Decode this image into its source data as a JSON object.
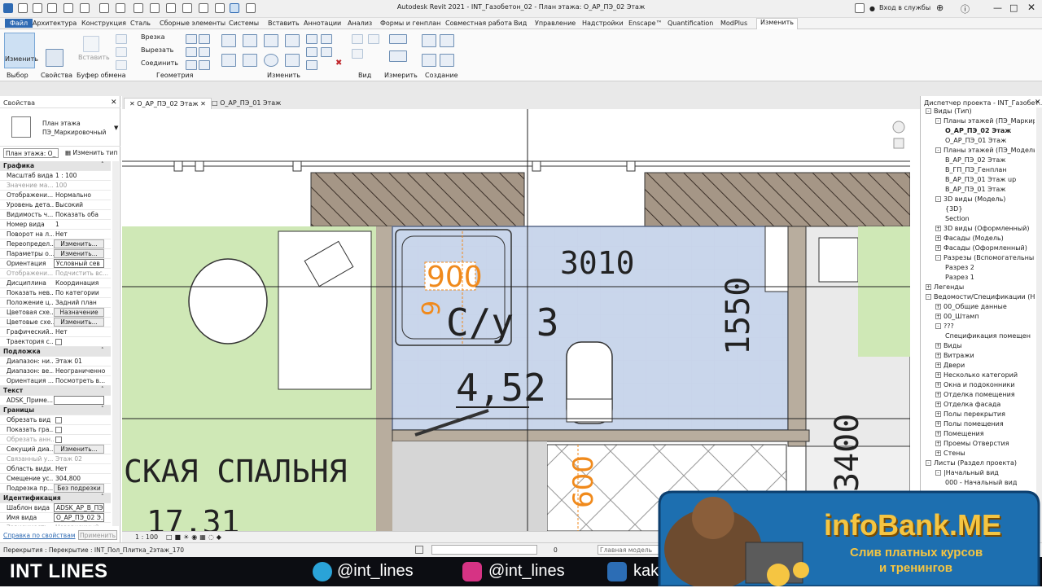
{
  "app": {
    "title": "Autodesk Revit 2021 - INT_Газобетон_02 - План этажа: О_АР_ПЭ_02 Этаж",
    "signin": "Вход в службы"
  },
  "ribbon": {
    "tabs": [
      "Файл",
      "Архитектура",
      "Конструкция",
      "Сталь",
      "Сборные элементы",
      "Системы",
      "Вставить",
      "Аннотации",
      "Анализ",
      "Формы и генплан",
      "Совместная работа",
      "Вид",
      "Управление",
      "Надстройки",
      "Enscape™",
      "Quantification",
      "ModPlus",
      "Изменить"
    ],
    "groups": [
      "Выбор",
      "Свойства",
      "Буфер обмена",
      "Геометрия",
      "Изменить",
      "Вид",
      "Измерить",
      "Создание"
    ],
    "modify_label": "Изменить",
    "insert_label": "Вставить",
    "cut_label": "Врезка",
    "trim_label": "Вырезать",
    "join_label": "Соединить"
  },
  "properties": {
    "title": "Свойства",
    "type_line1": "План этажа",
    "type_line2": "ПЭ_Маркировочный",
    "selector": "План этажа: О_",
    "edit_type": "Изменить тип",
    "rows": [
      {
        "k": "Графика",
        "sec": true
      },
      {
        "k": "Масштаб вида",
        "v": "1 : 100"
      },
      {
        "k": "Значение ма...",
        "v": "100",
        "dis": true
      },
      {
        "k": "Отображени...",
        "v": "Нормально"
      },
      {
        "k": "Уровень дета...",
        "v": "Высокий"
      },
      {
        "k": "Видимость ч...",
        "v": "Показать оба"
      },
      {
        "k": "Номер вида",
        "v": "1"
      },
      {
        "k": "Поворот на л...",
        "v": "Нет"
      },
      {
        "k": "Переопредел...",
        "btn": "Изменить..."
      },
      {
        "k": "Параметры о...",
        "btn": "Изменить..."
      },
      {
        "k": "Ориентация",
        "input": "Условный сев"
      },
      {
        "k": "Отображени...",
        "v": "Подчистить вс...",
        "dis": true
      },
      {
        "k": "Дисциплина",
        "v": "Координация"
      },
      {
        "k": "Показать нев...",
        "v": "По категории"
      },
      {
        "k": "Положение ц...",
        "v": "Задний план"
      },
      {
        "k": "Цветовая схе...",
        "btn": "Назначение"
      },
      {
        "k": "Цветовые схе...",
        "btn": "Изменить..."
      },
      {
        "k": "Графический...",
        "v": "Нет"
      },
      {
        "k": "Траектория с...",
        "cb": true
      },
      {
        "k": "Подложка",
        "sec": true
      },
      {
        "k": "Диапазон: ни...",
        "v": "Этаж 01"
      },
      {
        "k": "Диапазон: ве...",
        "v": "Неограниченно"
      },
      {
        "k": "Ориентация ...",
        "v": "Посмотреть в..."
      },
      {
        "k": "Текст",
        "sec": true
      },
      {
        "k": "ADSK_Приме...",
        "input": ""
      },
      {
        "k": "Границы",
        "sec": true
      },
      {
        "k": "Обрезать вид",
        "cb": true
      },
      {
        "k": "Показать гра...",
        "cb": true
      },
      {
        "k": "Обрезать анн...",
        "cb": true,
        "dis": true
      },
      {
        "k": "Секущий диа...",
        "btn": "Изменить..."
      },
      {
        "k": "Связанный у...",
        "v": "Этаж 02",
        "dis": true
      },
      {
        "k": "Область види...",
        "v": "Нет"
      },
      {
        "k": "Смещение ус...",
        "v": "304,800"
      },
      {
        "k": "Подрезка пр...",
        "btn": "Без подрезки"
      },
      {
        "k": "Идентификация",
        "sec": true
      },
      {
        "k": "Шаблон вида",
        "input": "ADSK_АР_В_ПЭ"
      },
      {
        "k": "Имя вида",
        "input": "О_АР_ПЭ_02 Э..."
      },
      {
        "k": "Зависимость",
        "v": "Независимый",
        "dis": true
      }
    ],
    "help_link": "Справка по свойствам",
    "apply": "Применить"
  },
  "view_tabs": [
    "О_АР_ПЭ_02 Этаж",
    "О_АР_ПЭ_01 Этаж"
  ],
  "drawing": {
    "dim_3010": "3010",
    "dim_900": "900",
    "dim_900_partial": "9",
    "room_name": "С/у 3",
    "room_area": "4,52",
    "dim_1550": "1550",
    "dim_3400": "3400",
    "dim_600": "600",
    "bedroom": "СКАЯ СПАЛЬНЯ",
    "bedroom_area": "17,31"
  },
  "view_control": {
    "scale": "1 : 100"
  },
  "browser": {
    "title": "Диспетчер проекта - INT_Газобет...",
    "items": [
      {
        "t": "Виды (Тип)",
        "lvl": 0,
        "tw": "-"
      },
      {
        "t": "Планы этажей (ПЭ_Маркиро",
        "lvl": 1,
        "tw": "-"
      },
      {
        "t": "О_АР_ПЭ_02 Этаж",
        "lvl": 2,
        "sel": true
      },
      {
        "t": "О_АР_ПЭ_01 Этаж",
        "lvl": 2
      },
      {
        "t": "Планы этажей (ПЭ_Модель",
        "lvl": 1,
        "tw": "-"
      },
      {
        "t": "В_АР_ПЭ_02 Этаж",
        "lvl": 2
      },
      {
        "t": "В_ГП_ПЭ_Генплан",
        "lvl": 2
      },
      {
        "t": "В_АР_ПЭ_01 Этаж up",
        "lvl": 2
      },
      {
        "t": "В_АР_ПЭ_01 Этаж",
        "lvl": 2
      },
      {
        "t": "3D виды (Модель)",
        "lvl": 1,
        "tw": "-"
      },
      {
        "t": "{3D}",
        "lvl": 2
      },
      {
        "t": "Section",
        "lvl": 2
      },
      {
        "t": "3D виды (Оформленный)",
        "lvl": 1,
        "tw": "+"
      },
      {
        "t": "Фасады (Модель)",
        "lvl": 1,
        "tw": "+"
      },
      {
        "t": "Фасады (Оформленный)",
        "lvl": 1,
        "tw": "+"
      },
      {
        "t": "Разрезы (Вспомогательный",
        "lvl": 1,
        "tw": "-"
      },
      {
        "t": "Разрез 2",
        "lvl": 2
      },
      {
        "t": "Разрез 1",
        "lvl": 2
      },
      {
        "t": "Легенды",
        "lvl": 0,
        "tw": "+"
      },
      {
        "t": "Ведомости/Спецификации (Н",
        "lvl": 0,
        "tw": "-"
      },
      {
        "t": "00_Общие данные",
        "lvl": 1,
        "tw": "+"
      },
      {
        "t": "00_Штамп",
        "lvl": 1,
        "tw": "+"
      },
      {
        "t": "???",
        "lvl": 1,
        "tw": "-"
      },
      {
        "t": "Спецификация помещен",
        "lvl": 2
      },
      {
        "t": "Виды",
        "lvl": 1,
        "tw": "+"
      },
      {
        "t": "Витражи",
        "lvl": 1,
        "tw": "+"
      },
      {
        "t": "Двери",
        "lvl": 1,
        "tw": "+"
      },
      {
        "t": "Несколько категорий",
        "lvl": 1,
        "tw": "+"
      },
      {
        "t": "Окна и подоконники",
        "lvl": 1,
        "tw": "+"
      },
      {
        "t": "Отделка помещения",
        "lvl": 1,
        "tw": "+"
      },
      {
        "t": "Отделка фасада",
        "lvl": 1,
        "tw": "+"
      },
      {
        "t": "Полы перекрытия",
        "lvl": 1,
        "tw": "+"
      },
      {
        "t": "Полы помещения",
        "lvl": 1,
        "tw": "+"
      },
      {
        "t": "Помещения",
        "lvl": 1,
        "tw": "+"
      },
      {
        "t": "Проемы Отверстия",
        "lvl": 1,
        "tw": "+"
      },
      {
        "t": "Стены",
        "lvl": 1,
        "tw": "+"
      },
      {
        "t": "Листы (Раздел проекта)",
        "lvl": 0,
        "tw": "-"
      },
      {
        "t": "|Начальный вид",
        "lvl": 1,
        "tw": "-"
      },
      {
        "t": "000 - Начальный вид",
        "lvl": 2
      }
    ]
  },
  "status": {
    "text": "Перекрытия : Перекрытие : INT_Пол_Плитка_2этаж_170",
    "zero": "0",
    "model": "Главная модель"
  },
  "overlay": {
    "brand": "INT LINES",
    "telegram": "@int_lines",
    "instagram": "@int_lines",
    "vk": "kak_",
    "promo_title": "infoBank.ME",
    "promo_sub1": "Слив платных курсов",
    "promo_sub2": "и тренингов"
  },
  "colors": {
    "room_fill": "#c7d6ee",
    "green_fill": "#cfe8b6",
    "hatch_fill": "#a59686",
    "dim_orange": "#f08a1c",
    "promo_blue": "#1d6fb0",
    "promo_gold": "#f5c542"
  }
}
